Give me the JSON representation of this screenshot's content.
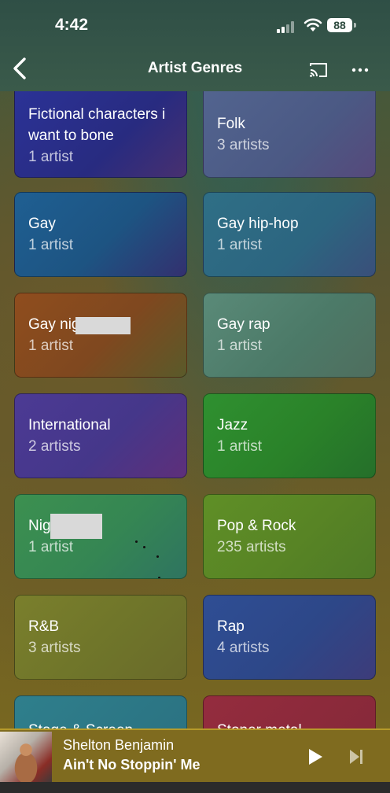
{
  "status": {
    "time": "4:42",
    "battery": "88"
  },
  "nav": {
    "title": "Artist Genres"
  },
  "genres": [
    {
      "name": "Fictional characters i want to bone",
      "count": "1 artist",
      "color": "#2b2f8c"
    },
    {
      "name": "Folk",
      "count": "3 artists",
      "color": "#4b5a86"
    },
    {
      "name": "Gay",
      "count": "1 artist",
      "color": "#1f5a8a"
    },
    {
      "name": "Gay hip-hop",
      "count": "1 artist",
      "color": "#2d6b82"
    },
    {
      "name": "Gay nig",
      "count": "1 artist",
      "color": "#8a4a1e"
    },
    {
      "name": "Gay rap",
      "count": "1 artist",
      "color": "#4f7f70"
    },
    {
      "name": "International",
      "count": "2 artists",
      "color": "#4a3d8f"
    },
    {
      "name": "Jazz",
      "count": "1 artist",
      "color": "#2f8a2f"
    },
    {
      "name": "Nig",
      "count": "1 artist",
      "color": "#3a8a55"
    },
    {
      "name": "Pop & Rock",
      "count": "235 artists",
      "color": "#5d8a26"
    },
    {
      "name": "R&B",
      "count": "3 artists",
      "color": "#737a2a"
    },
    {
      "name": "Rap",
      "count": "4 artists",
      "color": "#2e4a8a"
    },
    {
      "name": "Stage & Screen",
      "count": "",
      "color": "#2f7a86"
    },
    {
      "name": "Stoner metal",
      "count": "",
      "color": "#8a2a3a"
    }
  ],
  "player": {
    "artist": "Shelton Benjamin",
    "track": "Ain't No Stoppin' Me"
  }
}
